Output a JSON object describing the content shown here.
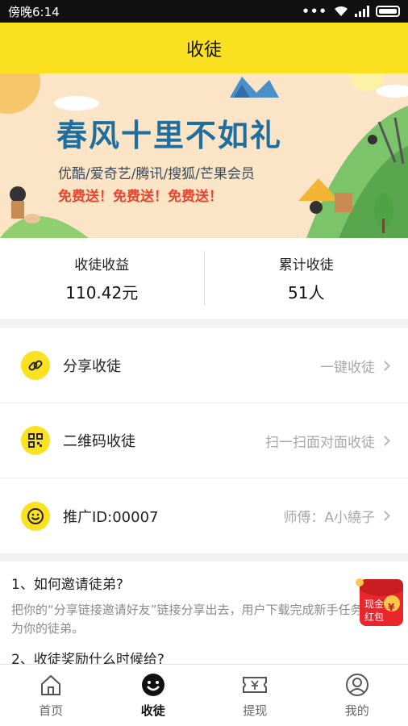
{
  "status_bar": {
    "time": "傍晚6:14",
    "dots": "•••"
  },
  "header": {
    "title": "收徒"
  },
  "banner": {
    "title": "春风十里不如礼",
    "subtitle": "优酷/爱奇艺/腾讯/搜狐/芒果会员",
    "promo": "免费送！免费送！免费送！"
  },
  "stats": [
    {
      "label": "收徒收益",
      "value": "110.42元"
    },
    {
      "label": "累计收徒",
      "value": "51人"
    }
  ],
  "menu": [
    {
      "label": "分享收徒",
      "value": "一键收徒",
      "icon": "link-icon"
    },
    {
      "label": "二维码收徒",
      "value": "扫一扫面对面收徒",
      "icon": "qrcode-icon"
    },
    {
      "label": "推广ID:00007",
      "value": "师傅：A小繞子",
      "icon": "smiley-icon"
    }
  ],
  "faq": [
    {
      "q": "1、如何邀请徒弟?",
      "a": "把你的“分享链接邀请好友”链接分享出去，用户下载完成新手任务就成为你的徒弟。"
    },
    {
      "q": "2、收徒奖励什么时候给?",
      "a": ""
    }
  ],
  "red_packet": {
    "line1": "现金",
    "line2": "红包",
    "symbol": "¥"
  },
  "tabbar": {
    "items": [
      {
        "label": "首页",
        "icon": "home-icon"
      },
      {
        "label": "收徒",
        "icon": "smiley-face-icon"
      },
      {
        "label": "提现",
        "icon": "ticket-yen-icon"
      },
      {
        "label": "我的",
        "icon": "user-icon"
      }
    ],
    "active_index": 1
  },
  "colors": {
    "accent": "#fbe11f",
    "promo_red": "#e8442e",
    "title_blue": "#1f6e9e"
  }
}
